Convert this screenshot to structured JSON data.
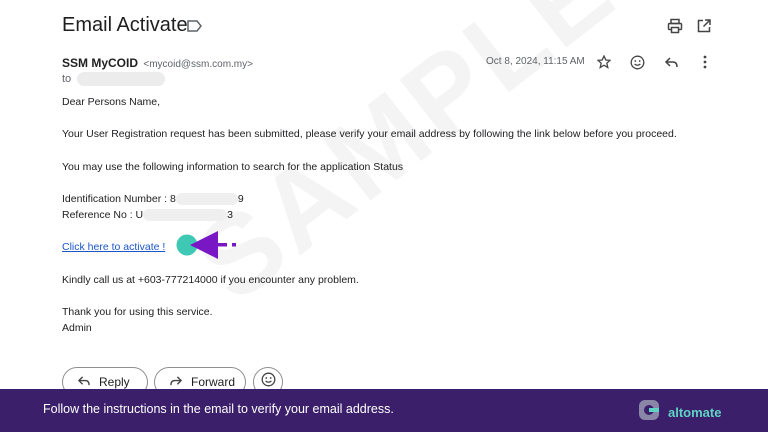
{
  "email": {
    "subject": "Email Activate",
    "sender_name": "SSM MyCOID",
    "sender_email": "<mycoid@ssm.com.my>",
    "to_label": "to",
    "date": "Oct 8, 2024, 11:15 AM"
  },
  "body": {
    "greeting": "Dear Persons Name,",
    "line1": "Your User Registration request has been submitted, please verify your email address by following the link below before you proceed.",
    "line2": "You may use the following information to search for the application Status",
    "id_label": "Identification Number : 8",
    "id_suffix": "9",
    "ref_label": "Reference No : U",
    "ref_suffix": "3",
    "activate_link": "Click here to activate !",
    "call_line": "Kindly call us at +603-777214000 if you encounter any problem.",
    "thanks": "Thank you for using this service.",
    "signature": "Admin"
  },
  "watermark": "SAMPLE",
  "actions": {
    "reply": "Reply",
    "forward": "Forward"
  },
  "banner": {
    "instruction": "Follow the instructions in the email to verify your email address.",
    "brand": "altomate"
  },
  "colors": {
    "banner_bg": "#3b1f6b",
    "brand_teal": "#5fd3c4",
    "pointer_purple": "#7a17c4",
    "link_blue": "#1a55c9"
  },
  "icons": [
    "label-icon",
    "print-icon",
    "open-in-new-icon",
    "star-icon",
    "emoji-icon",
    "reply-icon",
    "more-vert-icon",
    "forward-icon",
    "altomate-logo-icon",
    "pointer-arrow-icon"
  ]
}
